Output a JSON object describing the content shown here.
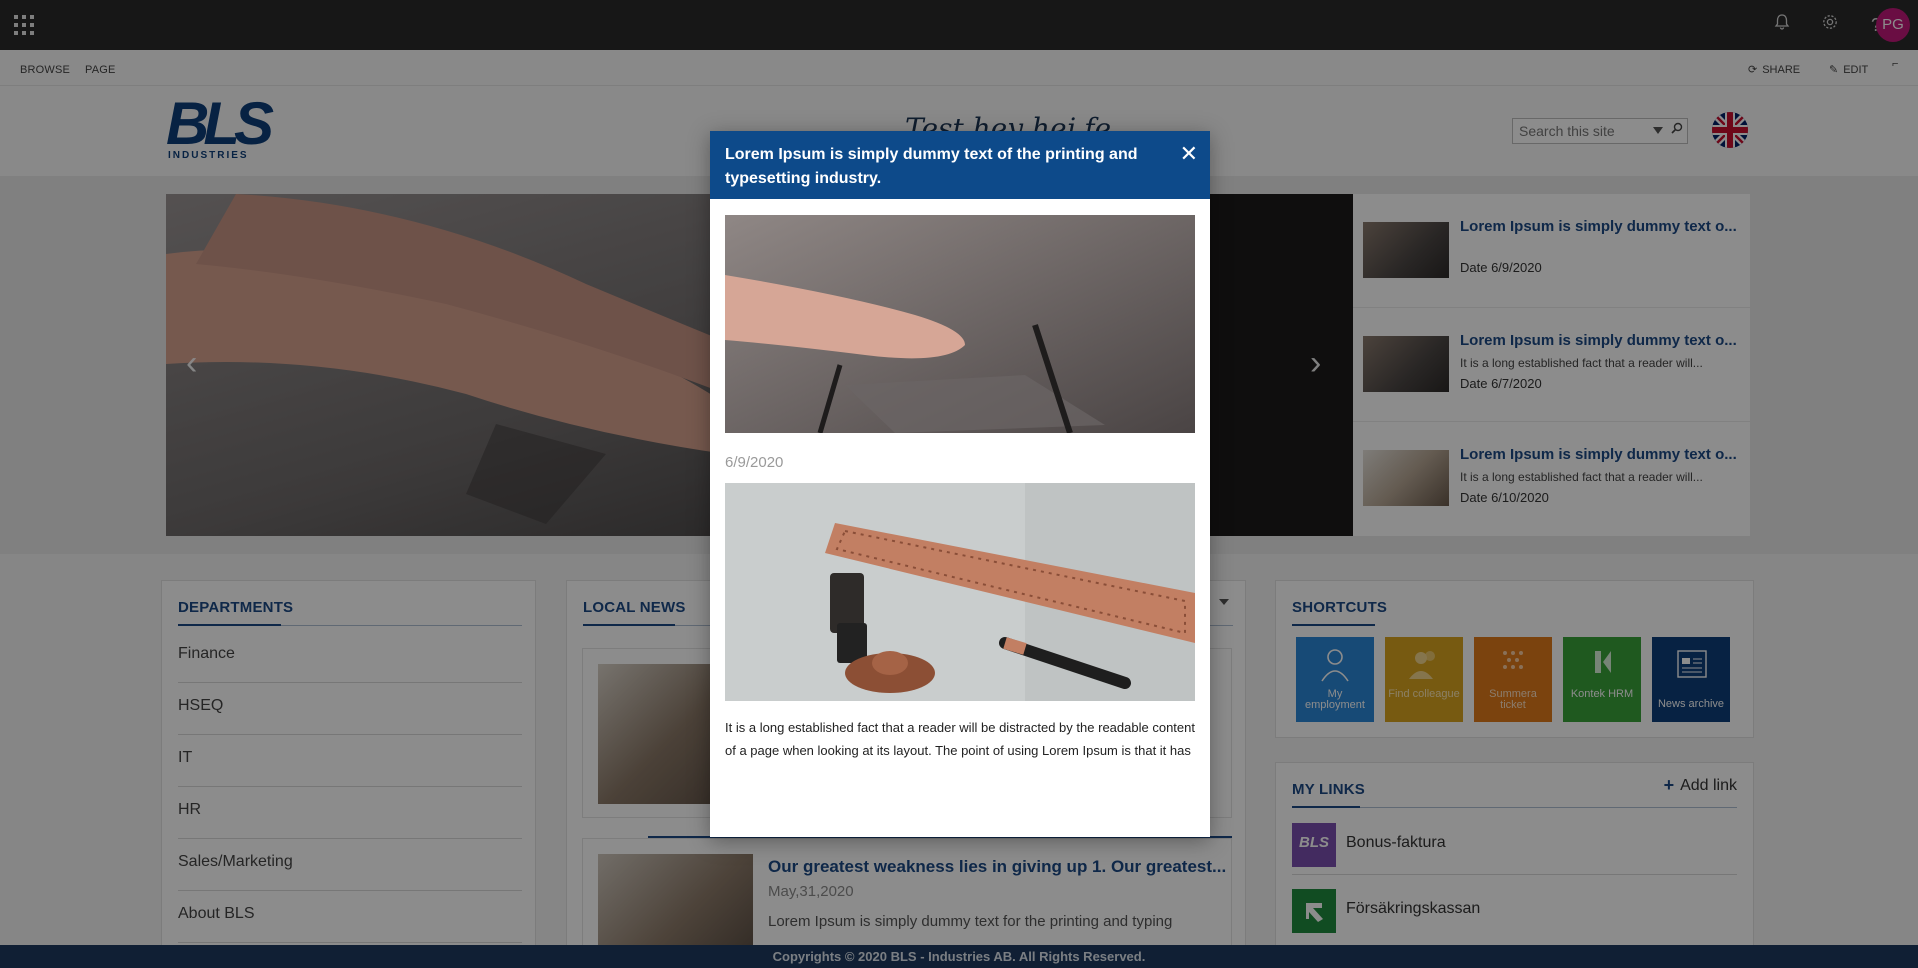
{
  "suitebar": {
    "avatar_initials": "PG",
    "icons": [
      "app-launcher-icon",
      "bell-icon",
      "gear-icon",
      "help-icon"
    ]
  },
  "ribbon": {
    "tabs": [
      "BROWSE",
      "PAGE"
    ],
    "share_label": "SHARE",
    "edit_label": "EDIT"
  },
  "header": {
    "logo_text": "BLS",
    "logo_sub": "INDUSTRIES",
    "site_title": "Test hey hej fe",
    "search_placeholder": "Search this site"
  },
  "side_news": [
    {
      "title": "Lorem Ipsum is simply dummy text o...",
      "desc": "",
      "date": "Date 6/9/2020"
    },
    {
      "title": "Lorem Ipsum is simply dummy text o...",
      "desc": "It is a long established fact that a reader will...",
      "date": "Date 6/7/2020"
    },
    {
      "title": "Lorem Ipsum is simply dummy text o...",
      "desc": "It is a long established fact that a reader will...",
      "date": "Date 6/10/2020"
    }
  ],
  "departments": {
    "heading": "DEPARTMENTS",
    "items": [
      "Finance",
      "HSEQ",
      "IT",
      "HR",
      "Sales/Marketing",
      "About BLS"
    ]
  },
  "local_news": {
    "heading": "LOCAL NEWS",
    "card2": {
      "title": "Our greatest weakness lies in giving up 1. Our greatest...",
      "date": "May,31,2020",
      "body": "Lorem Ipsum is simply dummy text for the printing and typing"
    }
  },
  "shortcuts": {
    "heading": "SHORTCUTS",
    "tiles": [
      {
        "label": "My employment",
        "color": "#2b88d8"
      },
      {
        "label": "Find colleague",
        "color": "#d9a520"
      },
      {
        "label": "Summera ticket",
        "color": "#e07b1a"
      },
      {
        "label": "Kontek HRM",
        "color": "#3aa23a"
      },
      {
        "label": "News archive",
        "color": "#0d3f7a"
      }
    ]
  },
  "my_links": {
    "heading": "MY LINKS",
    "add_label": "Add link",
    "items": [
      {
        "label": "Bonus-faktura",
        "color": "#7b4fb0"
      },
      {
        "label": "Försäkringskassan",
        "color": "#1f8a3e"
      }
    ]
  },
  "footer": {
    "text": "Copyrights © 2020 BLS - Industries AB. All Rights Reserved."
  },
  "modal": {
    "title": "Lorem Ipsum is simply dummy text of the printing and typesetting industry.",
    "date": "6/9/2020",
    "body": "It is a long established fact that a reader will be distracted by the readable content of a page when looking at its layout. The point of using Lorem Ipsum is that it has"
  },
  "colors": {
    "brand_blue": "#0d4a8a",
    "link_blue": "#1c4a85",
    "suitebar": "#2b2b2b",
    "footer": "#1e3a5f"
  }
}
